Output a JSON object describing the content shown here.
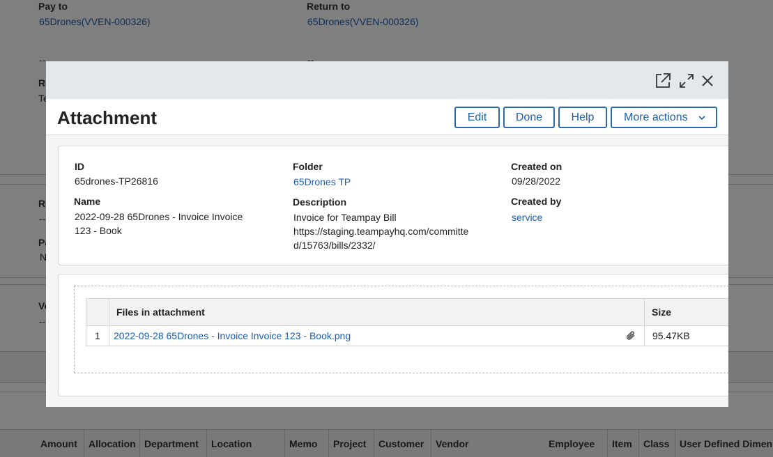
{
  "background": {
    "pay_to_label": "Pay to",
    "pay_to_value": "65Drones(VVEN-000326)",
    "return_to_label": "Return to",
    "return_to_value": "65Drones(VVEN-000326)",
    "dash1": "--",
    "dash2": "--",
    "frag_re1": "Re",
    "frag_te": "Te",
    "frag_re2": "Re",
    "frag_dash3": "--",
    "frag_pa": "Pa",
    "frag_n": "N",
    "frag_ve": "Ve",
    "frag_dash4": "--",
    "table_headers": [
      "Amount",
      "Allocation",
      "Department",
      "Location",
      "Memo",
      "Project",
      "Customer",
      "Vendor",
      "Employee",
      "Item",
      "Class",
      "User Defined Dimen"
    ]
  },
  "modal": {
    "title": "Attachment",
    "buttons": {
      "edit": "Edit",
      "done": "Done",
      "help": "Help",
      "more_actions": "More actions"
    },
    "icons": {
      "open_new": "external-link-icon",
      "expand": "expand-icon",
      "close": "close-icon"
    },
    "details": {
      "id_label": "ID",
      "id_value": "65drones-TP26816",
      "name_label": "Name",
      "name_value_line1": "2022-09-28 65Drones - Invoice Invoice",
      "name_value_line2": "123 - Book",
      "folder_label": "Folder",
      "folder_value": "65Drones TP",
      "description_label": "Description",
      "description_line1": "Invoice for Teampay Bill",
      "description_line2": "https://staging.teampayhq.com/committe",
      "description_line3": "d/15763/bills/2332/",
      "created_on_label": "Created on",
      "created_on_value": "09/28/2022",
      "created_by_label": "Created by",
      "created_by_value": "service"
    },
    "files": {
      "col_files": "Files in attachment",
      "col_size": "Size",
      "rows": [
        {
          "num": "1",
          "name": "2022-09-28 65Drones - Invoice Invoice 123 - Book.png",
          "size": "95.47KB"
        }
      ]
    }
  }
}
